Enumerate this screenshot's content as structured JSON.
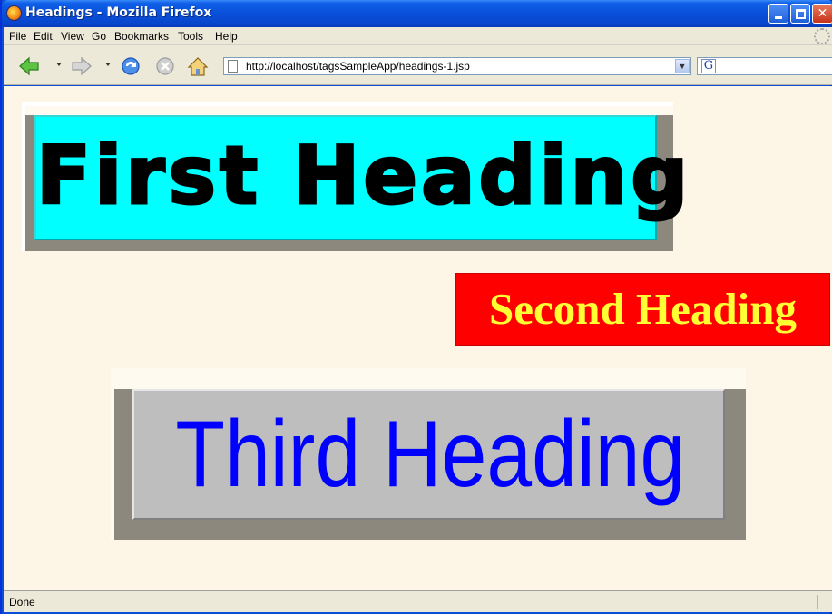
{
  "window": {
    "title": "Headings - Mozilla Firefox",
    "titlebar_color": "#0a50d8"
  },
  "menubar": {
    "items": [
      "File",
      "Edit",
      "View",
      "Go",
      "Bookmarks",
      "Tools",
      "Help"
    ]
  },
  "toolbar": {
    "url": "http://localhost/tagsSampleApp/headings-1.jsp",
    "search_engine_glyph": "G",
    "icons": [
      "back-icon",
      "forward-icon",
      "reload-icon",
      "stop-icon",
      "home-icon",
      "page-icon",
      "google-icon"
    ]
  },
  "content": {
    "background": "#fdf5e6",
    "heading_1": {
      "text": "First Heading",
      "background": "#00ffff",
      "color": "#000000"
    },
    "heading_2": {
      "text": "Second Heading",
      "background": "#ff0000",
      "color": "#ffff33"
    },
    "heading_3": {
      "text": "Third Heading",
      "background": "#bebebe",
      "color": "#0000ff"
    }
  },
  "statusbar": {
    "text": "Done"
  }
}
